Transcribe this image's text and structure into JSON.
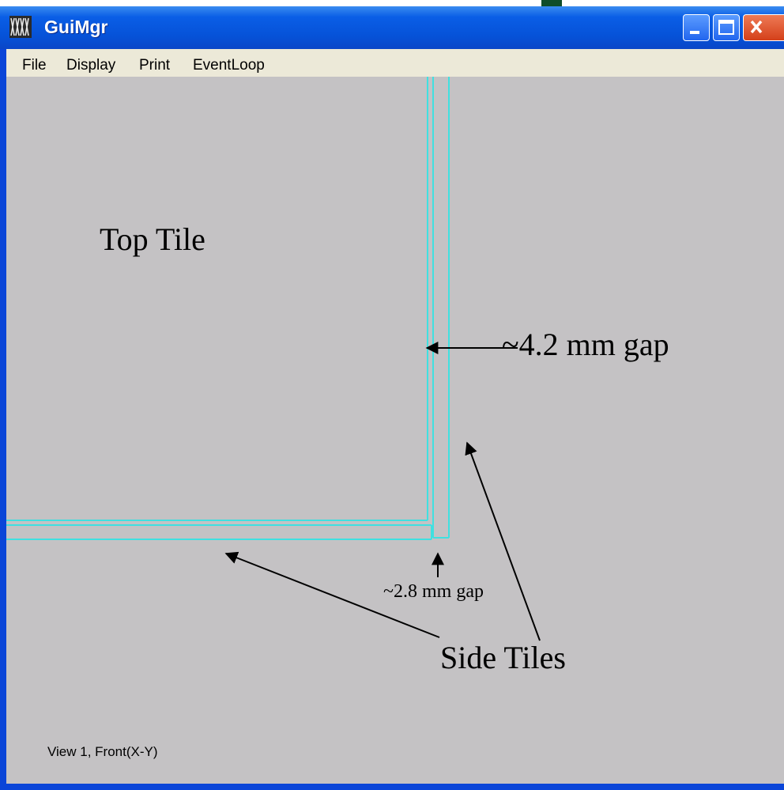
{
  "window": {
    "title": "GuiMgr",
    "colors": {
      "titlebar": "#0652d8",
      "frame": "#0a45d8",
      "menubar": "#ece9d8",
      "canvas": "#c4c2c4",
      "tile_outline": "#40e0e0"
    }
  },
  "menu": {
    "items": [
      "File",
      "Display",
      "Print",
      "EventLoop"
    ]
  },
  "annotations": {
    "top_tile": "Top Tile",
    "gap_right": "~4.2 mm gap",
    "gap_bottom": "~2.8 mm gap",
    "side_tiles": "Side Tiles"
  },
  "status": {
    "view": "View 1, Front(X-Y)"
  },
  "icons": {
    "app": "grid-app-icon",
    "minimize": "minimize-icon",
    "maximize": "maximize-icon",
    "close": "close-icon"
  }
}
